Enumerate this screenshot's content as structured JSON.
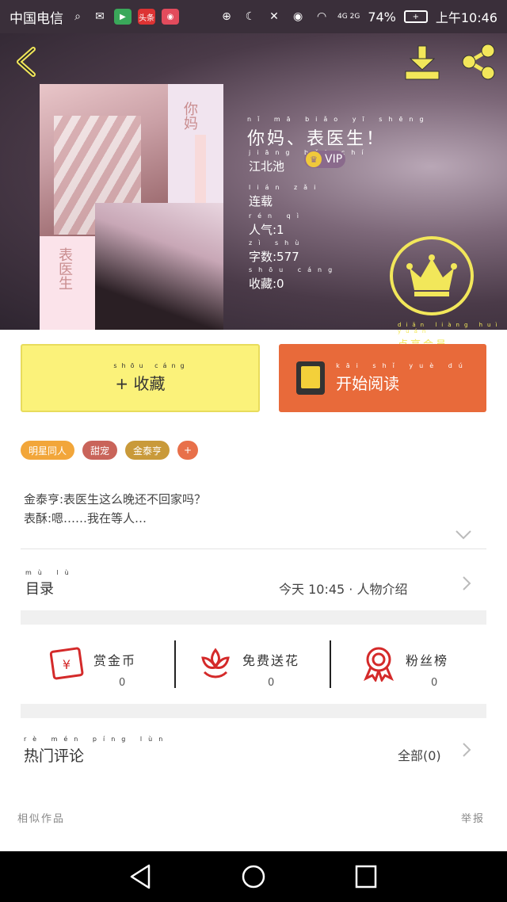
{
  "status_bar": {
    "carrier": "中国电信",
    "battery_pct": "74%",
    "network": "4G 2G",
    "time": "上午10:46",
    "app_badge": "头条"
  },
  "header": {
    "book_title": "你妈、表医生！",
    "book_title_pinyin": "nǐ mā biǎo yī shēng",
    "author": "江北池",
    "author_pinyin": "jiāng běi chí",
    "vip_label": "VIP",
    "status": "连载",
    "status_pinyin": "lián zǎi",
    "popularity": "人气:1",
    "popularity_pinyin": "rén qì",
    "word_count": "字数:577",
    "word_count_pinyin": "zì shù",
    "favorites": "收藏:0",
    "favorites_pinyin": "shōu cáng",
    "member_label": "点亮会员",
    "member_pinyin": "diǎn liàng huì yuán"
  },
  "actions": {
    "favorite": "+ 收藏",
    "favorite_pinyin": "shōu cáng",
    "read": "开始阅读",
    "read_pinyin": "kāi shǐ yuè dú"
  },
  "tags": [
    "明星同人",
    "甜宠",
    "金泰亨",
    "+"
  ],
  "intro": {
    "line1": "金泰亨:表医生这么晚还不回家吗？",
    "line2": "表酥:嗯……我在等人…"
  },
  "catalog": {
    "label": "目录",
    "label_pinyin": "mù lù",
    "update": "今天 10:45 · 人物介绍"
  },
  "stats": [
    {
      "label": "赏金币",
      "value": "0",
      "icon": "red-envelope-icon"
    },
    {
      "label": "免费送花",
      "value": "0",
      "icon": "flower-icon"
    },
    {
      "label": "粉丝榜",
      "value": "0",
      "icon": "medal-icon"
    }
  ],
  "comments": {
    "label": "热门评论",
    "label_pinyin": "rè mén píng lùn",
    "all": "全部(0)"
  },
  "footer": {
    "similar": "相似作品",
    "report": "举报"
  },
  "colors": {
    "accent_yellow": "#fbf27a",
    "accent_orange": "#e86a3a",
    "member_yellow": "#f2e75a"
  }
}
